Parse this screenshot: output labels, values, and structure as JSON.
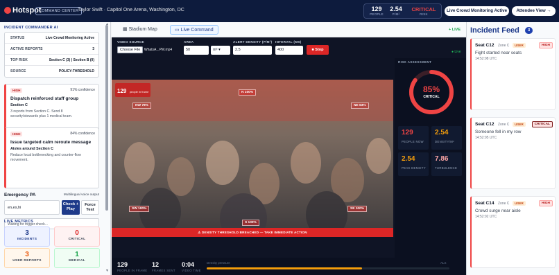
{
  "topbar": {
    "brand": "Hotspot",
    "badge": "COMMAND CENTER",
    "event": "Taylor Swift  ·  Capitol One Arena, Washington, DC",
    "stats": [
      {
        "value": "129",
        "label": "PEOPLE"
      },
      {
        "value": "2.54",
        "label": "P/M²"
      },
      {
        "value": "CRITICAL",
        "label": "RISK"
      }
    ],
    "live_button": "Live Crowd Monitoring Active",
    "attendee_button": "Attendee View →"
  },
  "left": {
    "title": "INCIDENT COMMANDER AI",
    "kv": [
      {
        "k": "STATUS",
        "v": "Live Crowd Monitoring Active"
      },
      {
        "k": "ACTIVE REPORTS",
        "v": "3"
      },
      {
        "k": "TOP RISK",
        "v": "Section C (3) | Section B (0)"
      },
      {
        "k": "SOURCE",
        "v": "POLICY-THRESHOLD"
      }
    ],
    "cards": [
      {
        "tag": "HIGH",
        "confidence": "91% confidence",
        "title": "Dispatch reinforced staff group",
        "subtitle": "Section C",
        "desc_1": "3 reports from Section C. Send 8",
        "desc_2": "security/stewards plus 1 medical team."
      },
      {
        "tag": "HIGH",
        "confidence": "84% confidence",
        "title": "Issue targeted calm reroute message",
        "subtitle": "Aisles around Section C",
        "desc_1": "Reduce local bottlenecking and counter-flow",
        "desc_2": "movement."
      }
    ],
    "pa": {
      "title": "Emergency PA",
      "multi": "Multilingual voice output",
      "lang_value": "en,es,hi",
      "check_label": "Check + Play",
      "force_label": "Force Test",
      "status": "Waiting for trigger check..."
    },
    "metrics_title": "LIVE METRICS",
    "metrics": [
      {
        "value": "3",
        "label": "INCIDENTS"
      },
      {
        "value": "0",
        "label": "CRITICAL"
      },
      {
        "value": "3",
        "label": "USER REPORTS"
      },
      {
        "value": "1",
        "label": "MEDICAL"
      }
    ]
  },
  "center": {
    "tabs": [
      {
        "label": "Stadium Map"
      },
      {
        "label": "Live Command"
      }
    ],
    "live_tag": "+ LIVE",
    "controls": {
      "video_label": "VIDEO SOURCE",
      "choose_file": "Choose File",
      "file_name": "WhatsA...PM.mp4",
      "area_label": "AREA",
      "area_value": "50",
      "unit_value": "m²",
      "density_label": "ALERT DENSITY (P/M²)",
      "density_value": "2.5",
      "interval_label": "INTERVAL (MS)",
      "interval_value": "400",
      "stop_label": "■ Stop",
      "live_indicator": "● Live"
    },
    "video": {
      "badge_count": "129",
      "badge_text": "people in frame",
      "zones": [
        "NW 78%",
        "N 100%",
        "NE 63%",
        "SW 100%",
        "S 100%",
        "SE 100%"
      ],
      "alert": "⚠ DENSITY THRESHOLD BREACHED — TAKE IMMEDIATE ACTION"
    },
    "risk": {
      "title": "RISK ASSESSMENT",
      "percent": "85%",
      "level": "CRITICAL",
      "cells": [
        {
          "value": "129",
          "label": "PEOPLE NOW"
        },
        {
          "value": "2.54",
          "label": "DENSITY/M²"
        },
        {
          "value": "2.54",
          "label": "PEAK DENSITY"
        },
        {
          "value": "7.86",
          "label": "TURBULENCE"
        }
      ]
    },
    "bottom": {
      "items": [
        {
          "value": "129",
          "label": "PEOPLE IN FRAME"
        },
        {
          "value": "12",
          "label": "FRAMES SENT"
        },
        {
          "value": "0:04",
          "label": "VIDEO TIME"
        }
      ],
      "density_label": "Density pressure",
      "bar_fill": 0.64,
      "bar_max": "ALS"
    },
    "colors": {
      "critical": "#dc2626",
      "accent": "#1e3a8a",
      "warn": "#f59e0b"
    }
  },
  "right": {
    "title": "Incident Feed",
    "count": "3",
    "items": [
      {
        "seat": "Seat C12",
        "zone": "Zone C",
        "source": "USER",
        "severity": "HIGH",
        "text": "Fight started near seats",
        "time": "14:52:08 UTC"
      },
      {
        "seat": "Seat C12",
        "zone": "Zone C",
        "source": "USER",
        "severity": "CRITICAL",
        "text": "Someone fell in my row",
        "time": "14:52:05 UTC"
      },
      {
        "seat": "Seat C14",
        "zone": "Zone C",
        "source": "USER",
        "severity": "HIGH",
        "text": "Crowd surge near aisle",
        "time": "14:52:02 UTC"
      }
    ]
  }
}
